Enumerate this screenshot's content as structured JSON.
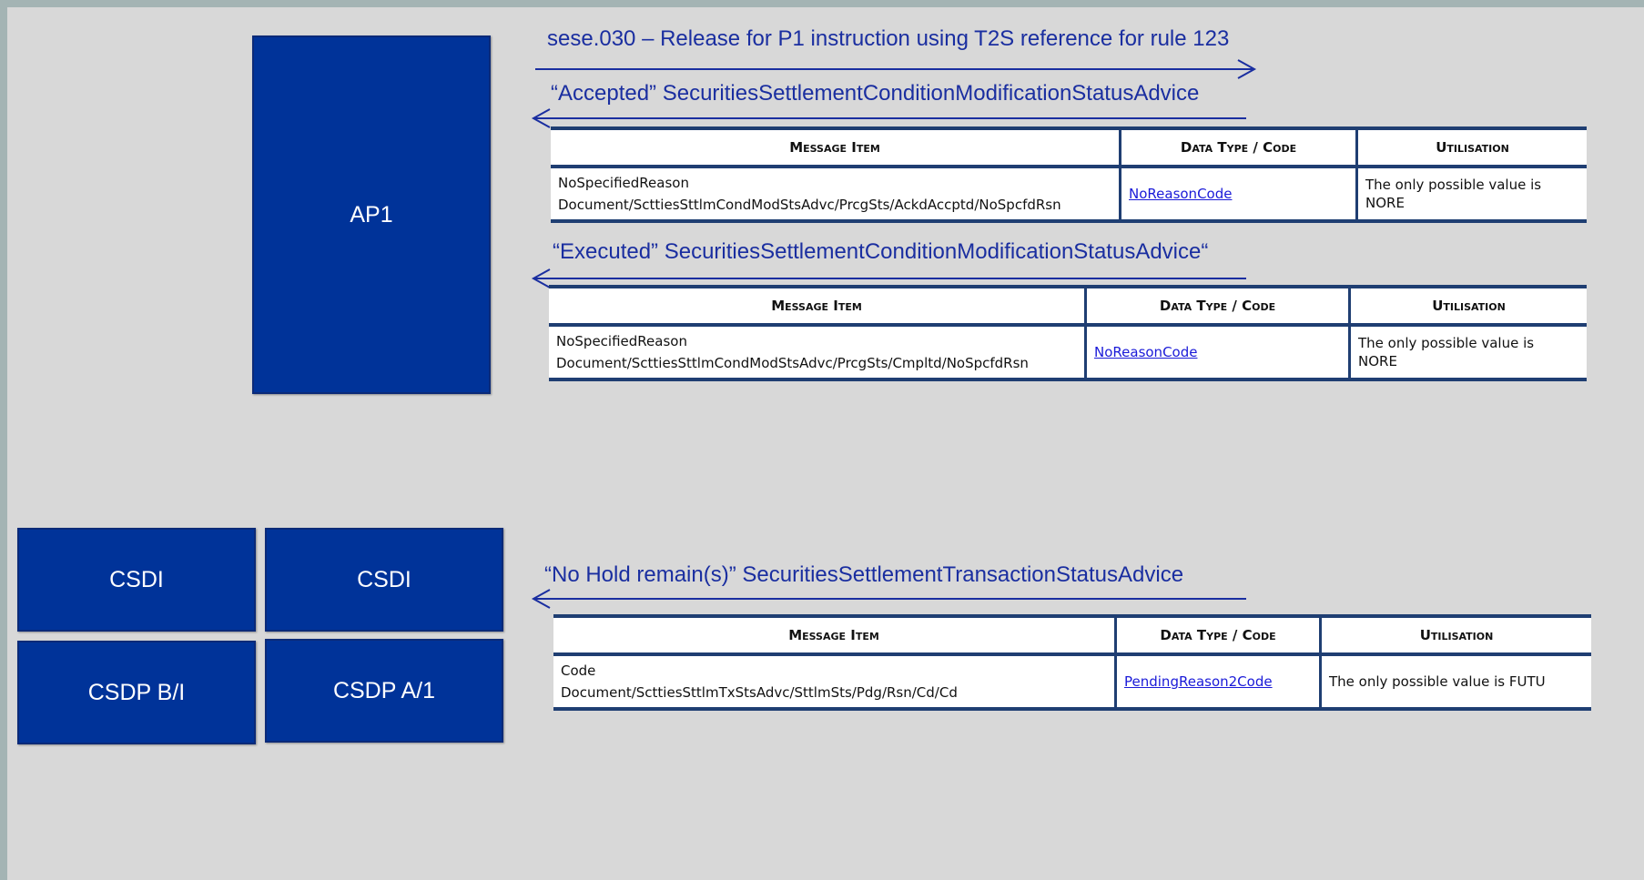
{
  "participants": {
    "ap1": "AP1",
    "csdi_left": "CSDI",
    "csdi_right": "CSDI",
    "csdp_b": "CSDP B/I",
    "csdp_a": "CSDP A/1"
  },
  "messages": {
    "m1": "sese.030 – Release for P1 instruction using T2S reference for rule 123",
    "m2": "“Accepted” SecuritiesSettlementConditionModificationStatusAdvice",
    "m3": "“Executed” SecuritiesSettlementConditionModificationStatusAdvice“",
    "m4": "“No Hold remain(s)” SecuritiesSettlementTransactionStatusAdvice"
  },
  "tables": {
    "t1": {
      "headers": [
        "Message Item",
        "Data Type / Code",
        "Utilisation"
      ],
      "item_name": "NoSpecifiedReason",
      "item_path": "Document/ScttiesSttlmCondModStsAdvc/PrcgSts/AckdAccptd/NoSpcfdRsn",
      "code": "NoReasonCode",
      "utilisation_1": "The only possible value is",
      "utilisation_2": "NORE"
    },
    "t2": {
      "headers": [
        "Message Item",
        "Data Type / Code",
        "Utilisation"
      ],
      "item_name": "NoSpecifiedReason",
      "item_path": "Document/ScttiesSttlmCondModStsAdvc/PrcgSts/Cmpltd/NoSpcfdRsn",
      "code": "NoReasonCode",
      "utilisation_1": "The only possible value is",
      "utilisation_2": "NORE"
    },
    "t3": {
      "headers": [
        "Message Item",
        "Data Type / Code",
        "Utilisation"
      ],
      "item_name": "Code",
      "item_path": "Document/ScttiesSttlmTxStsAdvc/SttlmSts/Pdg/Rsn/Cd/Cd",
      "code": "PendingReason2Code",
      "utilisation_1": "The only possible value is FUTU"
    }
  },
  "colors": {
    "box_fill": "#003399",
    "label_text": "#1a2ea0",
    "background": "#d8d8d8",
    "table_rule": "#1f3e72"
  }
}
